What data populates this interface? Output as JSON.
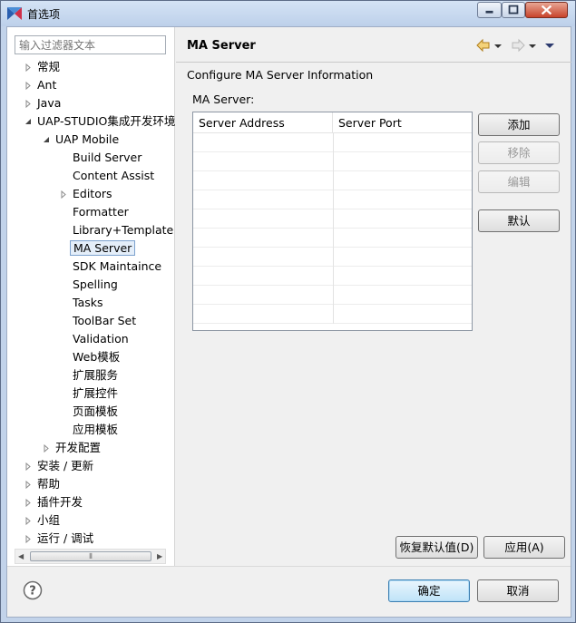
{
  "window": {
    "title": "首选项"
  },
  "filter": {
    "placeholder": "输入过滤器文本"
  },
  "tree": [
    {
      "label": "常规",
      "level": 0,
      "toggle": "collapsed"
    },
    {
      "label": "Ant",
      "level": 0,
      "toggle": "collapsed"
    },
    {
      "label": "Java",
      "level": 0,
      "toggle": "collapsed"
    },
    {
      "label": "UAP-STUDIO集成开发环境",
      "level": 0,
      "toggle": "expanded"
    },
    {
      "label": "UAP Mobile",
      "level": 1,
      "toggle": "expanded"
    },
    {
      "label": "Build Server",
      "level": 2,
      "toggle": "none"
    },
    {
      "label": "Content Assist",
      "level": 2,
      "toggle": "none"
    },
    {
      "label": "Editors",
      "level": 2,
      "toggle": "collapsed"
    },
    {
      "label": "Formatter",
      "level": 2,
      "toggle": "none"
    },
    {
      "label": "Library+Template",
      "level": 2,
      "toggle": "none"
    },
    {
      "label": "MA Server",
      "level": 2,
      "toggle": "none",
      "selected": true
    },
    {
      "label": "SDK Maintaince",
      "level": 2,
      "toggle": "none"
    },
    {
      "label": "Spelling",
      "level": 2,
      "toggle": "none"
    },
    {
      "label": "Tasks",
      "level": 2,
      "toggle": "none"
    },
    {
      "label": "ToolBar Set",
      "level": 2,
      "toggle": "none"
    },
    {
      "label": "Validation",
      "level": 2,
      "toggle": "none"
    },
    {
      "label": "Web模板",
      "level": 2,
      "toggle": "none"
    },
    {
      "label": "扩展服务",
      "level": 2,
      "toggle": "none"
    },
    {
      "label": "扩展控件",
      "level": 2,
      "toggle": "none"
    },
    {
      "label": "页面模板",
      "level": 2,
      "toggle": "none"
    },
    {
      "label": "应用模板",
      "level": 2,
      "toggle": "none"
    },
    {
      "label": "开发配置",
      "level": 1,
      "toggle": "collapsed"
    },
    {
      "label": "安装 / 更新",
      "level": 0,
      "toggle": "collapsed"
    },
    {
      "label": "帮助",
      "level": 0,
      "toggle": "collapsed"
    },
    {
      "label": "插件开发",
      "level": 0,
      "toggle": "collapsed"
    },
    {
      "label": "小组",
      "level": 0,
      "toggle": "collapsed"
    },
    {
      "label": "运行 / 调试",
      "level": 0,
      "toggle": "collapsed"
    }
  ],
  "page": {
    "title": "MA Server",
    "description": "Configure MA Server Information",
    "group_label": "MA Server:",
    "table": {
      "columns": [
        "Server Address",
        "Server Port"
      ],
      "rows": []
    },
    "buttons": {
      "add": "添加",
      "remove": "移除",
      "edit": "编辑",
      "default": "默认"
    },
    "restore_defaults": "恢复默认值(D)",
    "apply": "应用(A)"
  },
  "footer": {
    "ok": "确定",
    "cancel": "取消"
  }
}
